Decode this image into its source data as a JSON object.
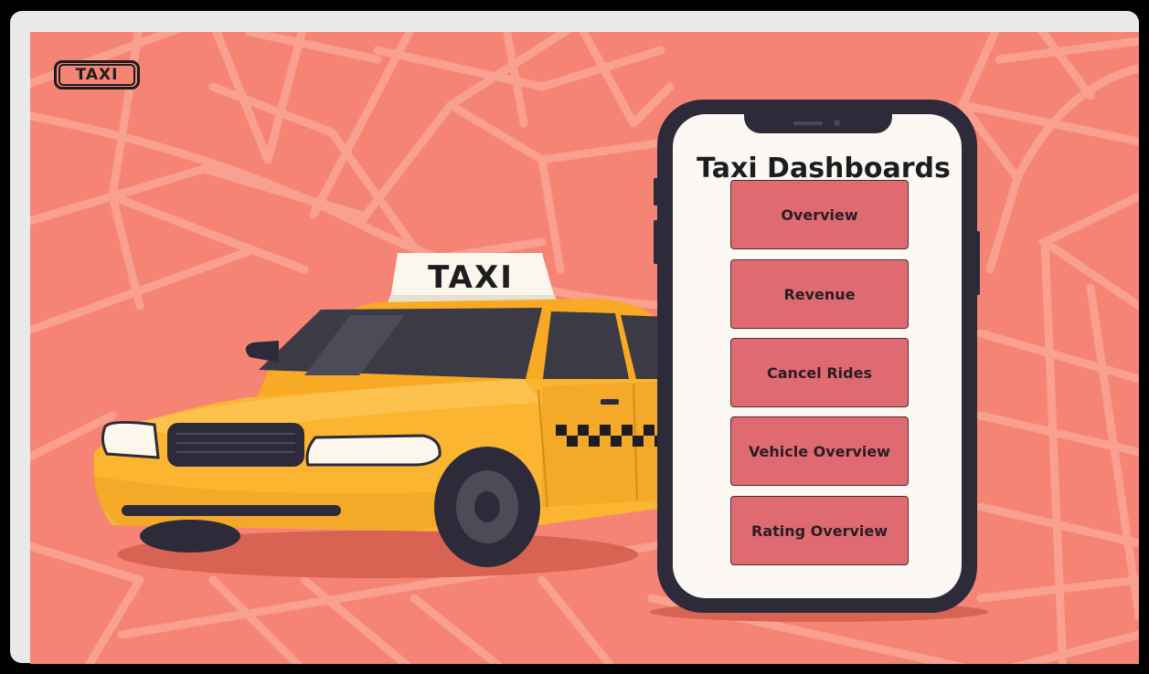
{
  "logo": {
    "text": "TAXI"
  },
  "car": {
    "roof_sign": "TAXI",
    "body_color": "#fbb531"
  },
  "phone": {
    "title": "Taxi Dashboards",
    "menu": [
      {
        "label": "Overview"
      },
      {
        "label": "Revenue"
      },
      {
        "label": "Cancel Rides"
      },
      {
        "label": "Vehicle Overview"
      },
      {
        "label": "Rating Overview"
      }
    ]
  },
  "colors": {
    "background": "#f58474",
    "map_lines": "#f9a090",
    "button": "#e06a72",
    "phone_frame": "#2d2b3a",
    "screen": "#fcf9f4"
  }
}
